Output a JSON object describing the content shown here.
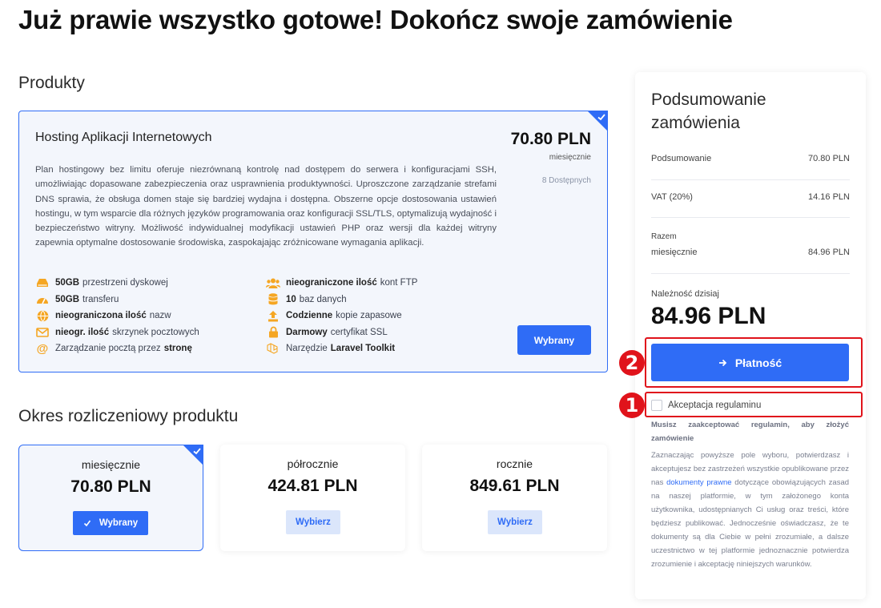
{
  "page": {
    "title": "Już prawie wszystko gotowe! Dokończ swoje zamówienie"
  },
  "products": {
    "section_title": "Produkty",
    "card": {
      "name": "Hosting Aplikacji Internetowych",
      "price": "70.80 PLN",
      "period": "miesięcznie",
      "stock": "8 Dostępnych",
      "description": "Plan hostingowy bez limitu oferuje niezrównaną kontrolę nad dostępem do serwera i konfiguracjami SSH, umożliwiając dopasowane zabezpieczenia oraz usprawnienia produktywności. Uproszczone zarządzanie strefami DNS sprawia, że obsługa domen staje się bardziej wydajna i dostępna. Obszerne opcje dostosowania ustawień hostingu, w tym wsparcie dla różnych języków programowania oraz konfiguracji SSL/TLS, optymalizują wydajność i bezpieczeństwo witryny. Możliwość indywidualnej modyfikacji ustawień PHP oraz wersji dla każdej witryny zapewnia optymalne dostosowanie środowiska, zaspokajając zróżnicowane wymagania aplikacji.",
      "selected_label": "Wybrany",
      "features_left": [
        {
          "icon": "disk-icon",
          "bold": "50GB",
          "text": "przestrzeni dyskowej"
        },
        {
          "icon": "speedometer-icon",
          "bold": "50GB",
          "text": "transferu"
        },
        {
          "icon": "globe-icon",
          "bold": "nieograniczona ilość",
          "text": "nazw"
        },
        {
          "icon": "envelope-icon",
          "bold": "nieogr. ilość",
          "text": "skrzynek pocztowych"
        },
        {
          "icon": "at-icon",
          "pre": "Zarządzanie pocztą przez",
          "bold": "stronę",
          "text": ""
        }
      ],
      "features_right": [
        {
          "icon": "users-icon",
          "bold": "nieograniczone ilość",
          "text": "kont FTP"
        },
        {
          "icon": "database-icon",
          "bold": "10",
          "text": "baz danych"
        },
        {
          "icon": "upload-icon",
          "bold": "Codzienne",
          "text": "kopie zapasowe"
        },
        {
          "icon": "lock-icon",
          "bold": "Darmowy",
          "text": "certyfikat SSL"
        },
        {
          "icon": "laravel-icon",
          "pre": "Narzędzie",
          "bold": "Laravel Toolkit",
          "text": ""
        }
      ]
    }
  },
  "billing": {
    "section_title": "Okres rozliczeniowy produktu",
    "options": [
      {
        "label": "miesięcznie",
        "price": "70.80 PLN",
        "button": "Wybrany",
        "selected": true
      },
      {
        "label": "półrocznie",
        "price": "424.81 PLN",
        "button": "Wybierz",
        "selected": false
      },
      {
        "label": "rocznie",
        "price": "849.61 PLN",
        "button": "Wybierz",
        "selected": false
      }
    ]
  },
  "summary": {
    "title_line1": "Podsumowanie",
    "title_line2": "zamówienia",
    "subtotal_label": "Podsumowanie",
    "subtotal_value": "70.80 PLN",
    "vat_label": "VAT (20%)",
    "vat_value": "14.16 PLN",
    "total_label": "Razem",
    "total_period": "miesięcznie",
    "total_value": "84.96 PLN",
    "due_label": "Należność dzisiaj",
    "due_amount": "84.96 PLN",
    "pay_button": "Płatność",
    "terms_label": "Akceptacja regulaminu",
    "terms_warning": "Musisz zaakceptować regulamin, aby złożyć zamówienie",
    "terms_text_before": "Zaznaczając powyższe pole wyboru, potwierdzasz i akceptujesz bez zastrzeżeń wszystkie opublikowane przez nas",
    "terms_link": "dokumenty prawne",
    "terms_text_after": "dotyczące obowiązujących zasad na naszej platformie, w tym założonego konta użytkownika, udostępnianych Ci usług oraz treści, które będziesz publikować. Jednocześnie oświadczasz, że te dokumenty są dla Ciebie w pełni zrozumiałe, a dalsze uczestnictwo w tej platformie jednoznacznie potwierdza zrozumienie i akceptację niniejszych warunków."
  },
  "annotations": {
    "badge_1": "1",
    "badge_2": "2"
  },
  "colors": {
    "accent": "#2f6cf6",
    "highlight": "#e0131b",
    "feature_icon": "#f5a623"
  }
}
